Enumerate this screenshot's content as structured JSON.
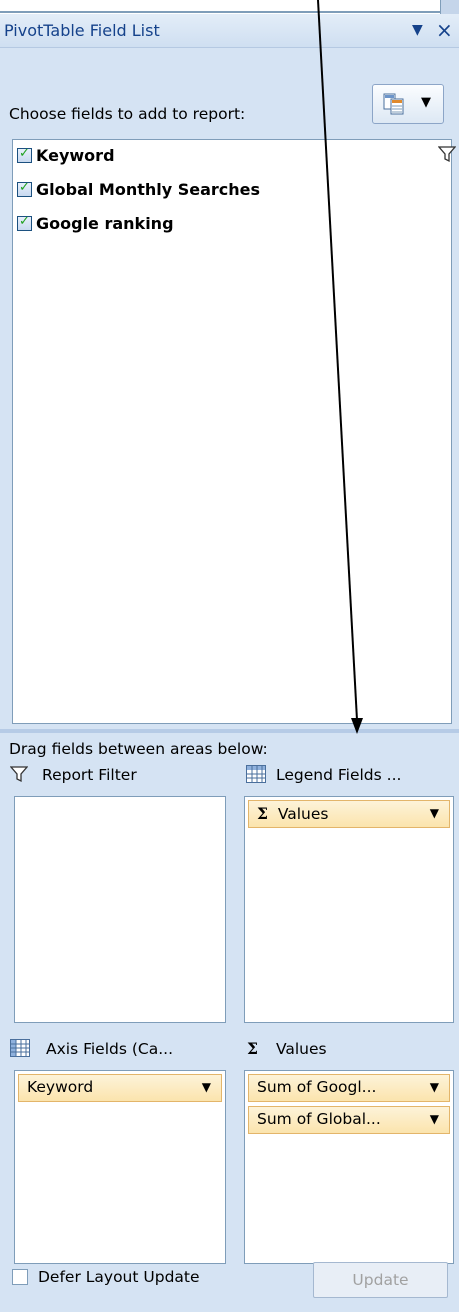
{
  "panel": {
    "title": "PivotTable Field List",
    "title_dropdown_icon": "chevron-down-icon",
    "close_label": "×"
  },
  "field_section": {
    "choose_label": "Choose fields to add to report:",
    "layout_icon": "layout-icon",
    "fields": [
      {
        "label": "Keyword",
        "checked": true,
        "filtered": true
      },
      {
        "label": "Global Monthly Searches",
        "checked": true
      },
      {
        "label": "Google ranking",
        "checked": true
      }
    ]
  },
  "areas": {
    "drag_label": "Drag fields between areas below:",
    "report_filter": {
      "label": "Report Filter",
      "icon": "filter-icon",
      "items": []
    },
    "legend_fields": {
      "label": "Legend Fields ...",
      "icon": "grid-icon",
      "items": [
        "Values"
      ]
    },
    "axis_fields": {
      "label": "Axis Fields (Ca...",
      "icon": "grid-icon",
      "items": [
        "Keyword"
      ]
    },
    "values": {
      "label": "Values",
      "icon": "sigma-icon",
      "items": [
        "Sum of Googl...",
        "Sum of Global..."
      ]
    },
    "sigma_symbol": "Σ"
  },
  "footer": {
    "defer_label": "Defer Layout Update",
    "defer_checked": false,
    "update_label": "Update"
  },
  "colors": {
    "panel_bg": "#d5e3f3",
    "title_text": "#15428b",
    "chip_bg": "#fbe4ad",
    "border": "#7f9db9"
  }
}
